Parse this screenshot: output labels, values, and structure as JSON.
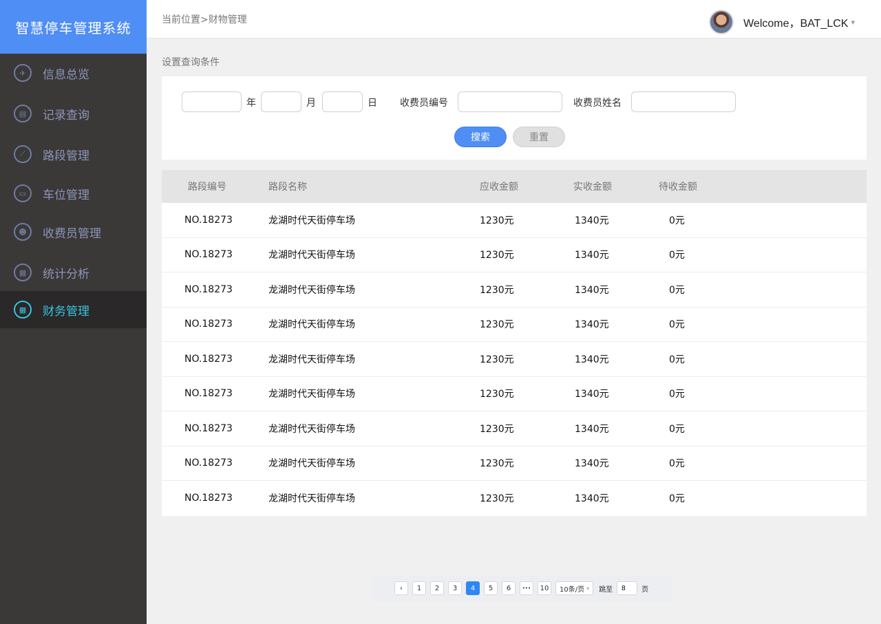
{
  "app": {
    "title": "智慧停车管理系统"
  },
  "sidebar": {
    "items": [
      {
        "label": "信息总览",
        "icon": "overview-icon",
        "glyph": "✈"
      },
      {
        "label": "记录查询",
        "icon": "record-icon",
        "glyph": "▤"
      },
      {
        "label": "路段管理",
        "icon": "chart-icon",
        "glyph": "⟋"
      },
      {
        "label": "车位管理",
        "icon": "car-icon",
        "glyph": "▭"
      },
      {
        "label": "收费员管理",
        "icon": "users-icon",
        "glyph": "☻"
      },
      {
        "label": "统计分析",
        "icon": "calculator-icon",
        "glyph": "▦"
      },
      {
        "label": "财务管理",
        "icon": "calculator-icon",
        "glyph": "▦",
        "active": true
      }
    ]
  },
  "header": {
    "breadcrumb": "当前位置>财物管理",
    "welcome": "Welcome，BAT_LCK",
    "caret": "▾"
  },
  "query": {
    "section_title": "设置查询条件",
    "year_label": "年",
    "month_label": "月",
    "day_label": "日",
    "collector_id_label": "收费员编号",
    "collector_name_label": "收费员姓名",
    "year_value": "",
    "month_value": "",
    "day_value": "",
    "collector_id_value": "",
    "collector_name_value": "",
    "search_label": "搜索",
    "reset_label": "重置"
  },
  "table": {
    "headers": [
      "路段编号",
      "路段名称",
      "应收金额",
      "实收金额",
      "待收金额"
    ],
    "rows": [
      [
        "NO.18273",
        "龙湖时代天街停车场",
        "1230元",
        "1340元",
        "0元"
      ],
      [
        "NO.18273",
        "龙湖时代天街停车场",
        "1230元",
        "1340元",
        "0元"
      ],
      [
        "NO.18273",
        "龙湖时代天街停车场",
        "1230元",
        "1340元",
        "0元"
      ],
      [
        "NO.18273",
        "龙湖时代天街停车场",
        "1230元",
        "1340元",
        "0元"
      ],
      [
        "NO.18273",
        "龙湖时代天街停车场",
        "1230元",
        "1340元",
        "0元"
      ],
      [
        "NO.18273",
        "龙湖时代天街停车场",
        "1230元",
        "1340元",
        "0元"
      ],
      [
        "NO.18273",
        "龙湖时代天街停车场",
        "1230元",
        "1340元",
        "0元"
      ],
      [
        "NO.18273",
        "龙湖时代天街停车场",
        "1230元",
        "1340元",
        "0元"
      ],
      [
        "NO.18273",
        "龙湖时代天街停车场",
        "1230元",
        "1340元",
        "0元"
      ]
    ]
  },
  "pagination": {
    "prev": "‹",
    "pages": [
      "1",
      "2",
      "3",
      "4",
      "5",
      "6"
    ],
    "current": "4",
    "ellipsis": "•••",
    "last": "10",
    "page_size": "10条/页",
    "page_size_caret": "▾",
    "jump_label": "跳至",
    "jump_value": "8",
    "page_unit": "页"
  },
  "colors": {
    "brand": "#4f8ef5",
    "sidebar_bg": "#3b3838",
    "active_text": "#39c3e0",
    "page_active": "#2f86f6"
  }
}
